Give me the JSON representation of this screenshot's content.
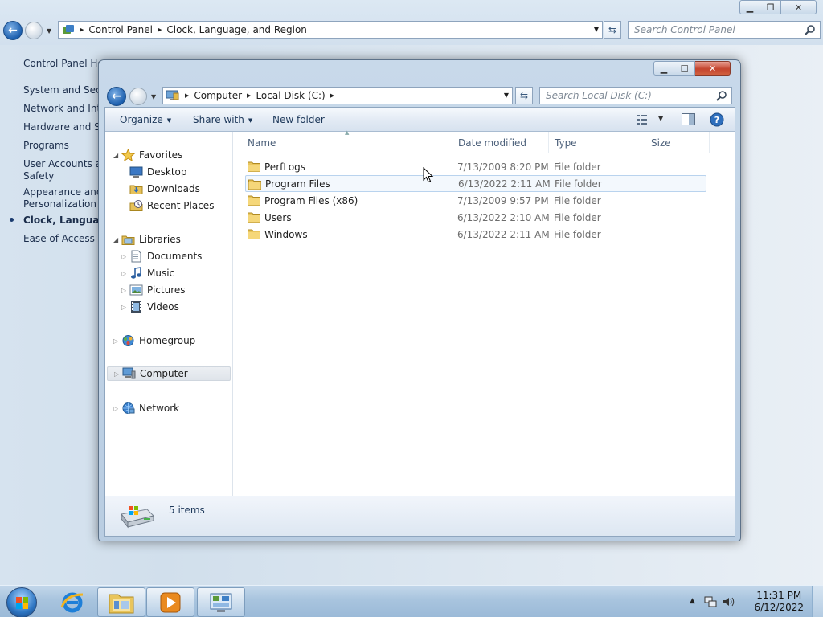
{
  "control_panel": {
    "breadcrumb": [
      "Control Panel",
      "Clock, Language, and Region"
    ],
    "search_placeholder": "Search Control Panel",
    "sidebar": {
      "home": "Control Panel Ho",
      "items": [
        "System and Secu",
        "Network and Inte",
        "Hardware and So",
        "Programs",
        "User Accounts an",
        "Safety",
        "Appearance and",
        "Personalization",
        "Clock, Language,",
        "Ease of Access"
      ]
    }
  },
  "explorer": {
    "breadcrumb": [
      "Computer",
      "Local Disk (C:)"
    ],
    "search_placeholder": "Search Local Disk (C:)",
    "toolbar": {
      "organize": "Organize",
      "share_with": "Share with",
      "new_folder": "New folder"
    },
    "nav_tree": {
      "favorites": "Favorites",
      "favorites_items": [
        "Desktop",
        "Downloads",
        "Recent Places"
      ],
      "libraries": "Libraries",
      "libraries_items": [
        "Documents",
        "Music",
        "Pictures",
        "Videos"
      ],
      "homegroup": "Homegroup",
      "computer": "Computer",
      "network": "Network"
    },
    "columns": [
      "Name",
      "Date modified",
      "Type",
      "Size"
    ],
    "files": [
      {
        "name": "PerfLogs",
        "date": "7/13/2009 8:20 PM",
        "type": "File folder"
      },
      {
        "name": "Program Files",
        "date": "6/13/2022 2:11 AM",
        "type": "File folder"
      },
      {
        "name": "Program Files (x86)",
        "date": "7/13/2009 9:57 PM",
        "type": "File folder"
      },
      {
        "name": "Users",
        "date": "6/13/2022 2:10 AM",
        "type": "File folder"
      },
      {
        "name": "Windows",
        "date": "6/13/2022 2:11 AM",
        "type": "File folder"
      }
    ],
    "status": "5 items"
  },
  "taskbar": {
    "time": "11:31 PM",
    "date": "6/12/2022"
  }
}
